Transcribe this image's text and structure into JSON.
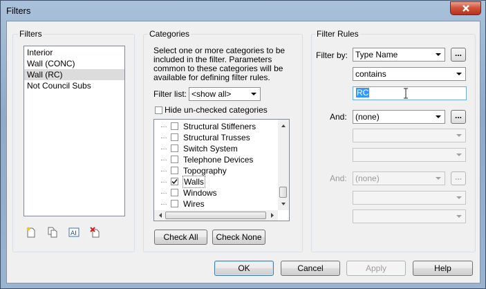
{
  "window": {
    "title": "Filters"
  },
  "filters": {
    "group_label": "Filters",
    "items": [
      {
        "label": "Interior",
        "selected": false
      },
      {
        "label": "Wall (CONC)",
        "selected": false
      },
      {
        "label": "Wall (RC)",
        "selected": true
      },
      {
        "label": "Not Council Subs",
        "selected": false
      }
    ],
    "toolbar": [
      "new-filter-icon",
      "duplicate-filter-icon",
      "rename-filter-icon",
      "delete-filter-icon"
    ]
  },
  "categories": {
    "group_label": "Categories",
    "description": "Select one or more categories to be included in the filter.  Parameters common to these categories will be available for defining filter rules.",
    "filter_list_label": "Filter list:",
    "filter_list_value": "<show all>",
    "hide_unchecked_label": "Hide un-checked categories",
    "hide_unchecked_checked": false,
    "items": [
      {
        "label": "Structural Stiffeners",
        "checked": false
      },
      {
        "label": "Structural Trusses",
        "checked": false
      },
      {
        "label": "Switch System",
        "checked": false
      },
      {
        "label": "Telephone Devices",
        "checked": false
      },
      {
        "label": "Topography",
        "checked": false
      },
      {
        "label": "Walls",
        "checked": true
      },
      {
        "label": "Windows",
        "checked": false
      },
      {
        "label": "Wires",
        "checked": false
      }
    ],
    "check_all_label": "Check All",
    "check_none_label": "Check None"
  },
  "filter_rules": {
    "group_label": "Filter Rules",
    "filter_by_label": "Filter by:",
    "filter_by_value": "Type Name",
    "operator_value": "contains",
    "value_text": "RC",
    "and1_label": "And:",
    "and1_value": "(none)",
    "and2_label": "And:",
    "and2_value": "(none)",
    "more_label": "..."
  },
  "buttons": {
    "ok": "OK",
    "cancel": "Cancel",
    "apply": "Apply",
    "help": "Help"
  },
  "colors": {
    "selection": "#3399ff",
    "close_button": "#c7432b"
  }
}
